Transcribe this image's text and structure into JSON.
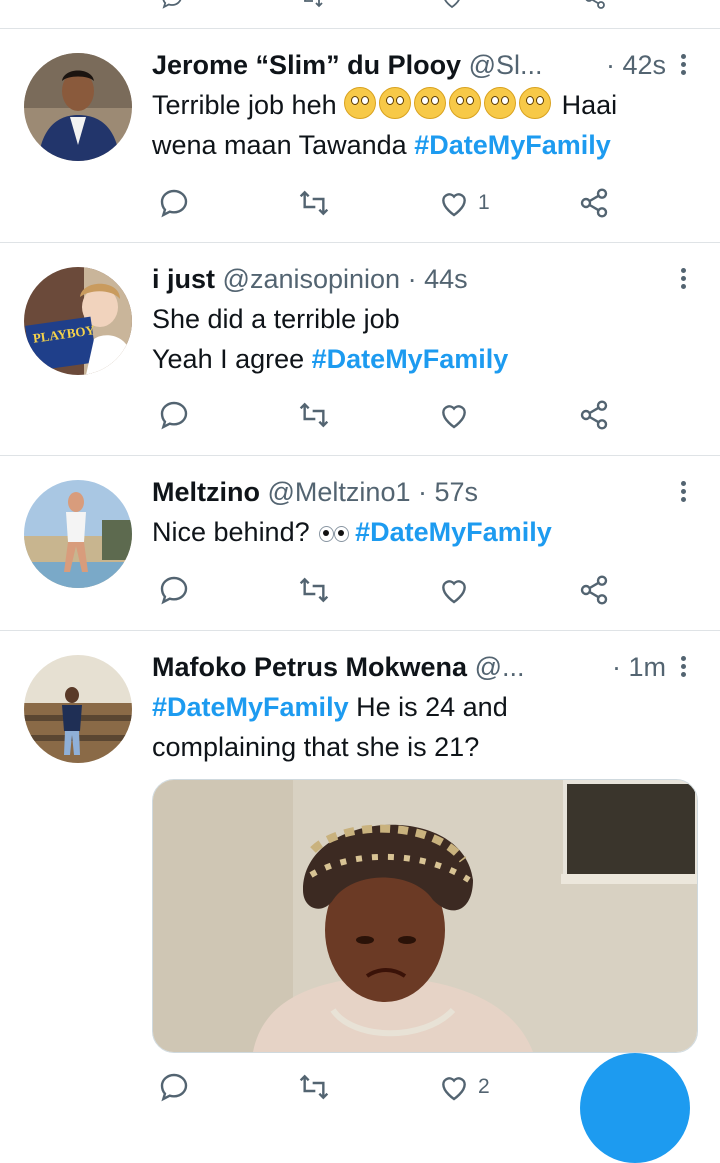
{
  "tweets": [
    {
      "name": "Jerome “Slim” du Plooy",
      "handle": "@Sl...",
      "time": "· 42s",
      "text_line1": "Terrible job heh",
      "text_line1_after": "Haai",
      "text_line2": "wena maan Tawanda",
      "hashtag": "#DateMyFamily",
      "like_count": "1"
    },
    {
      "name": "i just",
      "handle": "@zanisopinion",
      "time": "· 44s",
      "text_line1": "She did a terrible job",
      "text_line2": "Yeah I agree",
      "hashtag": "#DateMyFamily",
      "avatar_text": "PLAYBOY"
    },
    {
      "name": "Meltzino",
      "handle": "@Meltzino1",
      "time": "· 57s",
      "text_line1": "Nice behind?",
      "hashtag": "#DateMyFamily"
    },
    {
      "name": "Mafoko Petrus Mokwena",
      "handle": "@...",
      "time": "· 1m",
      "hashtag": "#DateMyFamily",
      "text_line1_after": "He is 24 and",
      "text_line2": "complaining that she is 21?",
      "like_count": "2"
    }
  ],
  "colors": {
    "accent": "#1d9bf0",
    "text": "#0f1419",
    "muted": "#536471",
    "divider": "#dfe3e6"
  },
  "icons": [
    "reply-icon",
    "retweet-icon",
    "like-icon",
    "share-icon",
    "more-icon"
  ]
}
